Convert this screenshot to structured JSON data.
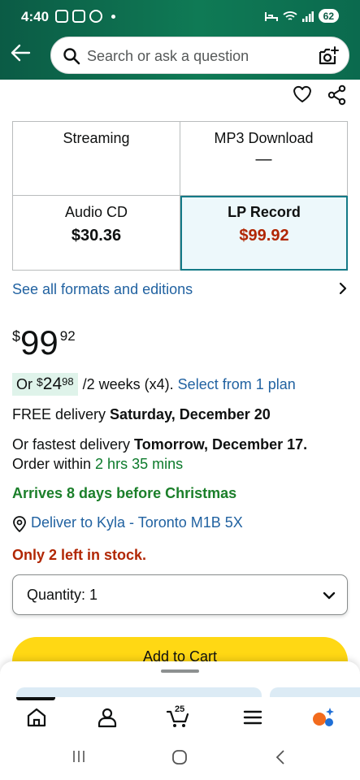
{
  "status_bar": {
    "time": "4:40",
    "battery": "62"
  },
  "search": {
    "placeholder": "Search or ask a question"
  },
  "formats": [
    {
      "name": "Streaming",
      "price": ""
    },
    {
      "name": "MP3 Download",
      "price": "—"
    },
    {
      "name": "Audio CD",
      "price": "$30.36"
    },
    {
      "name": "LP Record",
      "price": "$99.92",
      "selected": true
    }
  ],
  "see_all_label": "See all formats and editions",
  "price": {
    "currency": "$",
    "whole": "99",
    "fraction": "92"
  },
  "installment": {
    "prefix": "Or ",
    "currency": "$",
    "whole": "24",
    "fraction": "98",
    "per": "/2 weeks (x4).",
    "plan_link": "Select from 1 plan"
  },
  "delivery": {
    "free_prefix": "FREE delivery ",
    "free_date": "Saturday, December 20",
    "fastest_prefix": "Or fastest delivery ",
    "fastest_date": "Tomorrow, December 17.",
    "within_prefix": "Order within ",
    "within_time": "2 hrs 35 mins",
    "arrives": "Arrives 8 days before Christmas",
    "deliver_to": "Deliver to Kyla - Toronto M1B 5X"
  },
  "stock": "Only 2 left in stock.",
  "quantity_label": "Quantity: 1",
  "add_to_cart_label": "Add to Cart",
  "bottom_nav": {
    "cart_count": "25",
    "items": [
      "home-icon",
      "account-icon",
      "cart-icon",
      "menu-icon",
      "rufus-icon"
    ]
  },
  "colors": {
    "header_green": "#0f7a55",
    "link_blue": "#2162a1",
    "price_red": "#b12704",
    "success_green": "#0c7a2b",
    "cart_yellow": "#ffd814",
    "selected_border": "#147a87"
  }
}
